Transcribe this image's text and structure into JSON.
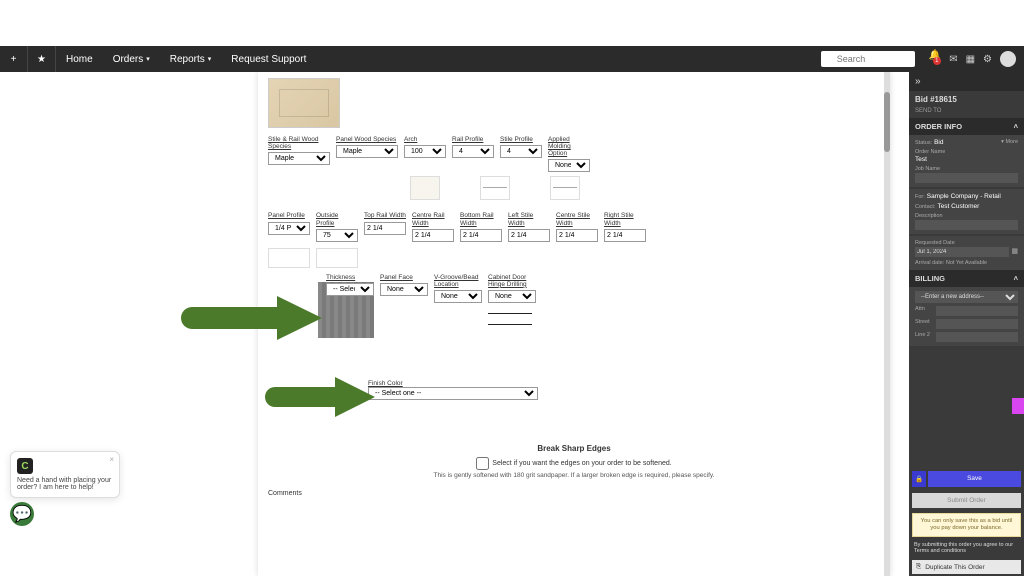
{
  "topbar": {
    "home": "Home",
    "orders": "Orders",
    "reports": "Reports",
    "support": "Request Support",
    "search_placeholder": "Search",
    "notif_badge": "1"
  },
  "door": {
    "row1": [
      {
        "label": "Stile & Rail Wood Species",
        "value": "Maple"
      },
      {
        "label": "Panel Wood Species",
        "value": "Maple"
      },
      {
        "label": "Arch",
        "value": "100"
      },
      {
        "label": "Rail Profile",
        "value": "4"
      },
      {
        "label": "Stile Profile",
        "value": "4"
      },
      {
        "label": "Applied Molding Option",
        "value": "None"
      }
    ],
    "row2": [
      {
        "label": "Panel Profile",
        "value": "1/4 P"
      },
      {
        "label": "Outside Profile",
        "value": "75"
      },
      {
        "label": "Top Rail Width",
        "value": "2 1/4"
      },
      {
        "label": "Centre Rail Width",
        "value": "2 1/4"
      },
      {
        "label": "Bottom Rail Width",
        "value": "2 1/4"
      },
      {
        "label": "Left Stile Width",
        "value": "2 1/4"
      },
      {
        "label": "Centre Stile Width",
        "value": "2 1/4"
      },
      {
        "label": "Right Stile Width",
        "value": "2 1/4"
      }
    ],
    "row3": [
      {
        "label": "Thickness",
        "value": "-- Select one --"
      },
      {
        "label": "Panel Face",
        "value": "None"
      },
      {
        "label": "V-Groove/Bead Location",
        "value": "None"
      },
      {
        "label": "Cabinet Door Hinge Drilling",
        "value": "None"
      }
    ],
    "finish": {
      "label": "Finish Color",
      "value": "-- Select one --"
    },
    "bse": {
      "title": "Break Sharp Edges",
      "checkbox": "Select if you want the edges on your order to be softened.",
      "note": "This is gently softened with 180 grit sandpaper. If a larger broken edge is required, please specify."
    },
    "comments_label": "Comments"
  },
  "side": {
    "bid": "Bid #18615",
    "sendto": "SEND TO",
    "orderinfo": "ORDER INFO",
    "status_k": "Status:",
    "status_v": "Bid",
    "more": "More",
    "ordername_k": "Order Name",
    "ordername_v": "Test",
    "jobname_k": "Job Name",
    "for_k": "For:",
    "for_v": "Sample Company - Retail",
    "contact_k": "Contact:",
    "contact_v": "Test Customer",
    "desc_k": "Description",
    "reqdate_k": "Requested Date",
    "reqdate_v": "Jul 1, 2024",
    "arrival": "Arrival date: Not Yet Available",
    "billing": "BILLING",
    "newaddr": "--Enter a new address--",
    "attn": "Attn",
    "street": "Street",
    "line2": "Line 2",
    "save": "Save",
    "submit": "Submit Order",
    "note": "You can only save this as a bid until you pay down your balance.",
    "terms": "By submitting this order you agree to our Terms and conditions",
    "dup": "Duplicate This Order"
  },
  "chat": {
    "msg": "Need a hand with placing your order? I am here to help!"
  }
}
